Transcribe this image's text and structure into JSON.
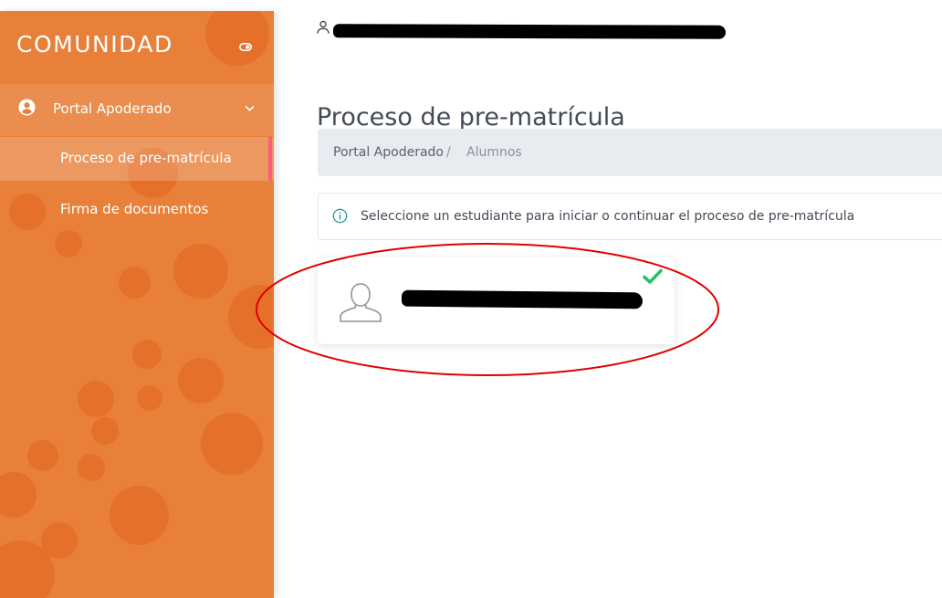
{
  "sidebar": {
    "brand": "COMUNIDAD",
    "group": {
      "label": "Portal Apoderado",
      "icon": "user-circle-icon",
      "expanded": true
    },
    "items": [
      {
        "label": "Proceso de pre-matrícula",
        "active": true
      },
      {
        "label": "Firma de documentos",
        "active": false
      }
    ]
  },
  "header": {
    "user_icon": "user-icon",
    "user_name_redacted": true
  },
  "main": {
    "title": "Proceso de pre-matrícula",
    "breadcrumb": {
      "items": [
        "Portal Apoderado",
        "Alumnos"
      ],
      "separator": "/"
    },
    "alert": {
      "icon": "info-circle-icon",
      "text": "Seleccione un estudiante para iniciar o continuar el proceso de pre-matrícula"
    },
    "student_card": {
      "avatar_icon": "user-outline-icon",
      "name_redacted": true,
      "status_icon": "check-icon"
    }
  },
  "colors": {
    "sidebar_bg": "#e8803a",
    "bubble": "#e2621e",
    "active_marker": "#ff5b7f",
    "breadcrumb_bg": "#e8ebef",
    "check": "#2dbd6e",
    "annotation": "#e00000",
    "title_text": "#444a55"
  }
}
